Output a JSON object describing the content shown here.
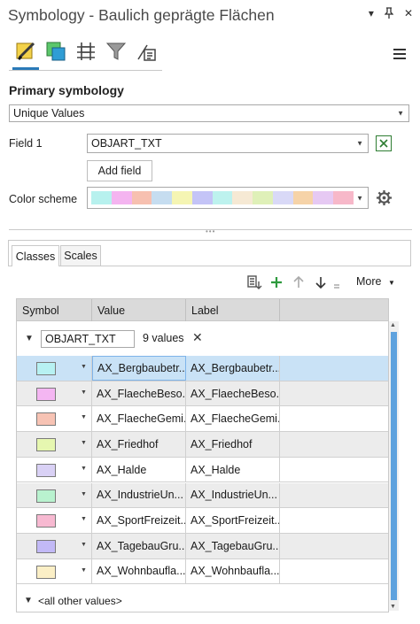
{
  "window": {
    "title": "Symbology - Baulich geprägte Flächen",
    "dropdown_glyph": "▾",
    "pin_glyph": "ᵖ",
    "close_glyph": "✕"
  },
  "tool_tabs": [
    {
      "name": "primary-symbology-tab-icon"
    },
    {
      "name": "vary-symbology-tab-icon"
    },
    {
      "name": "symbol-layers-tab-icon"
    },
    {
      "name": "filter-tab-icon"
    },
    {
      "name": "label-tab-icon"
    }
  ],
  "primary": {
    "heading": "Primary symbology",
    "method": "Unique Values",
    "field1_label": "Field 1",
    "field1_value": "OBJART_TXT",
    "add_field": "Add field",
    "color_scheme_label": "Color scheme",
    "color_scheme": [
      "#b7f1ee",
      "#f4b4f0",
      "#f7c0b0",
      "#c6ddf0",
      "#f5f5b3",
      "#c4c4f7",
      "#bdf2ee",
      "#f6e9d4",
      "#dff0b8",
      "#d9d9f7",
      "#f6d3a8",
      "#e6c9f3",
      "#f7b8c9"
    ]
  },
  "tabs": {
    "classes": "Classes",
    "scales": "Scales"
  },
  "toolbar": {
    "more": "More"
  },
  "grid": {
    "headers": {
      "symbol": "Symbol",
      "value": "Value",
      "label": "Label"
    },
    "group": {
      "field": "OBJART_TXT",
      "count": "9 values"
    },
    "rows": [
      {
        "value": "AX_Bergbaubetr...",
        "label": "AX_Bergbaubetr...",
        "color": "#b7f1f2",
        "selected": true
      },
      {
        "value": "AX_FlaecheBeso...",
        "label": "AX_FlaecheBeso...",
        "color": "#f4b6f2",
        "selected": false
      },
      {
        "value": "AX_FlaecheGemi...",
        "label": "AX_FlaecheGemi...",
        "color": "#f7c3b4",
        "selected": false
      },
      {
        "value": "AX_Friedhof",
        "label": "AX_Friedhof",
        "color": "#e6f7b0",
        "selected": false
      },
      {
        "value": "AX_Halde",
        "label": "AX_Halde",
        "color": "#d9d1f5",
        "selected": false
      },
      {
        "value": "AX_IndustrieUn...",
        "label": "AX_IndustrieUn...",
        "color": "#b9f2cf",
        "selected": false
      },
      {
        "value": "AX_SportFreizeit...",
        "label": "AX_SportFreizeit...",
        "color": "#f7b9d1",
        "selected": false
      },
      {
        "value": "AX_TagebauGru...",
        "label": "AX_TagebauGru...",
        "color": "#c2b9f6",
        "selected": false
      },
      {
        "value": "AX_Wohnbaufla...",
        "label": "AX_Wohnbaufla...",
        "color": "#fbefc6",
        "selected": false
      }
    ],
    "other_values": "<all other values>"
  }
}
